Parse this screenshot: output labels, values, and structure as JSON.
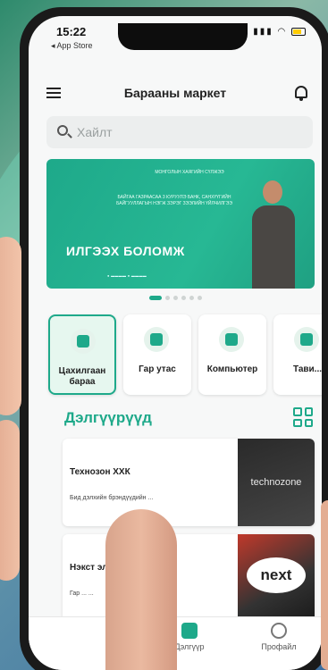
{
  "status": {
    "time": "15:22",
    "back": "◂ App Store"
  },
  "header": {
    "title": "Барааны маркет"
  },
  "search": {
    "placeholder": "Хайлт"
  },
  "banner": {
    "logo": "МОНГОЛЫН ХАЯГИЙН СҮЛЖЭЭ",
    "description": "БАЙГАА ГАЗРААСАА 3 КУРУУЛЭ БАНК, САНХҮҮГИЙН БАЙГУУЛЛАГЫН НЭГЖ ЗЭРЭГ ЗЭЭЛИЙН ҮЙЛЧИЛГЭЭ",
    "headline": "ИЛГЭЭХ БОЛОМЖ"
  },
  "categories": [
    {
      "label": "Цахилгаан бараа"
    },
    {
      "label": "Гар утас"
    },
    {
      "label": "Компьютер"
    },
    {
      "label": "Тави..."
    }
  ],
  "section": {
    "title": "Дэлгүүрүүд"
  },
  "shops": [
    {
      "name": "Технозон ХХК",
      "description": "Бид дэлхийн брэндүүдийн ...",
      "image_text": "technozone"
    },
    {
      "name": "Нэкст эл...",
      "description": "Гар ... ...",
      "image_text": "next"
    }
  ],
  "tabbar": {
    "items": [
      {
        "label": "Дэлгүүр"
      },
      {
        "label": "Профайл"
      }
    ]
  },
  "colors": {
    "accent": "#1ea98a",
    "background": "#f7f8f8"
  }
}
